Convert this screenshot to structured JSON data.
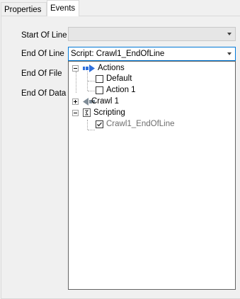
{
  "tabs": [
    "Properties",
    "Events"
  ],
  "rows": [
    {
      "label": "Start Of Line",
      "value": ""
    },
    {
      "label": "End Of Line",
      "value": "Script: Crawl1_EndOfLine"
    },
    {
      "label": "End Of File"
    },
    {
      "label": "End Of Data"
    }
  ],
  "tree": {
    "actions": {
      "label": "Actions",
      "items": [
        "Default",
        "Action 1"
      ]
    },
    "crawl": {
      "label": "Crawl 1"
    },
    "scripting": {
      "label": "Scripting",
      "items": [
        "Crawl1_EndOfLine"
      ]
    }
  },
  "colors": {
    "accent": "#0078d7",
    "arrow_blue": "#2f6fdc",
    "arrow_gray": "#7f8c97",
    "disabled_text": "#6d6d6d"
  }
}
